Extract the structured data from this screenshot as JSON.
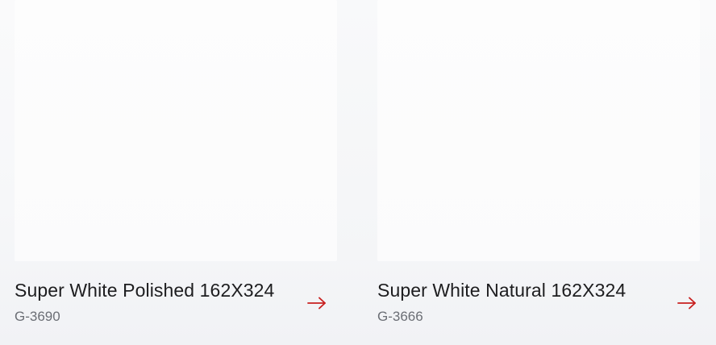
{
  "products": [
    {
      "name": "Super White Polished 162X324",
      "code": "G-3690",
      "arrow_icon": "arrow-right-icon"
    },
    {
      "name": "Super White Natural 162X324",
      "code": "G-3666",
      "arrow_icon": "arrow-right-icon"
    }
  ],
  "colors": {
    "accent": "#c8201f",
    "title": "#1d1d1f",
    "code": "#6b6e75"
  }
}
